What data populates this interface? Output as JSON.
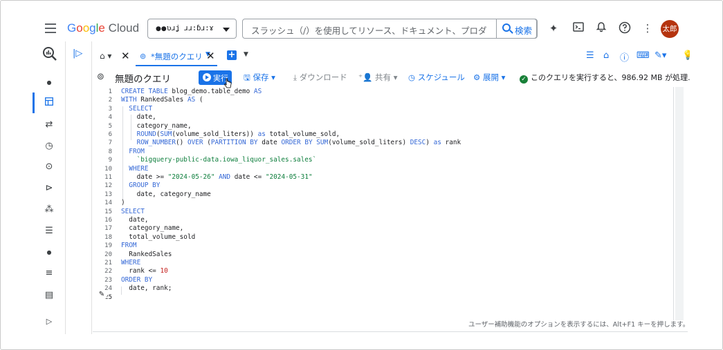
{
  "topbar": {
    "logo_google": "Google",
    "logo_cloud": "Cloud",
    "project_name": "ʋɹʝ ɹɹ:ɓɹ:ɤ",
    "search_placeholder": "スラッシュ（/）を使用してリソース、ドキュメント、プロダ...",
    "search_button": "検索",
    "avatar_text": "太郎"
  },
  "tabs": {
    "query_tab_label": "*無題のクエリ"
  },
  "query": {
    "title": "無題のクエリ",
    "run_label": "実行",
    "save_label": "保存",
    "download_label": "ダウンロード",
    "share_label": "共有",
    "schedule_label": "スケジュール",
    "deploy_label": "展開",
    "status_text": "このクエリを実行すると、986.92 MB が処理..."
  },
  "editor": {
    "line_numbers": [
      "1",
      "2",
      "3",
      "4",
      "5",
      "6",
      "7",
      "8",
      "9",
      "10",
      "11",
      "12",
      "13",
      "14",
      "15",
      "16",
      "17",
      "18",
      "19",
      "20",
      "21",
      "22",
      "23",
      "24",
      "25"
    ],
    "accessibility_hint": "ユーザー補助機能のオプションを表示するには、Alt+F1 キーを押します。"
  }
}
